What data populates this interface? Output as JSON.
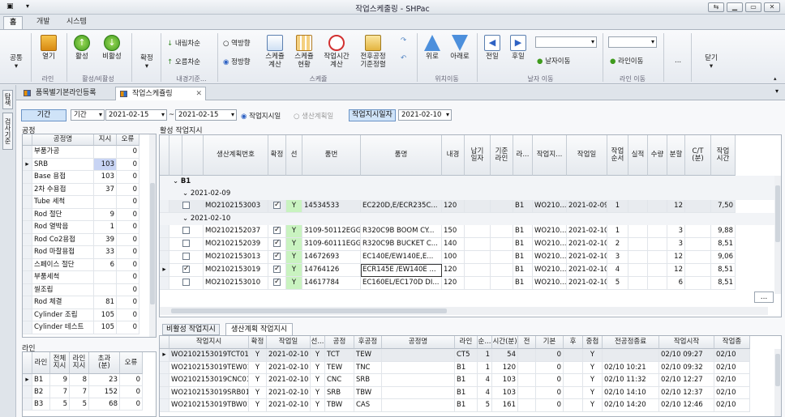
{
  "window": {
    "title": "작업스케줄링 - SHPac",
    "minimize": "▁",
    "restore": "▭",
    "close": "✕",
    "extra": "⇆",
    "menu": "▾"
  },
  "ribbon_tabs": [
    "홈",
    "개발",
    "시스템"
  ],
  "ribbon": {
    "buttons": [
      {
        "label": "공통",
        "icon": "common-icon"
      },
      {
        "label": "열기",
        "icon": "open-icon"
      },
      {
        "label": "활성",
        "icon": "activate-icon"
      },
      {
        "label": "비활성",
        "icon": "deactivate-icon"
      },
      {
        "label": "확정",
        "icon": "confirm-icon"
      },
      {
        "label": "스케쥴\n계산",
        "icon": "schedule-calc-icon"
      },
      {
        "label": "스케쥴\n현황",
        "icon": "schedule-status-icon"
      },
      {
        "label": "작업시간\n계산",
        "icon": "worktime-calc-icon"
      },
      {
        "label": "전후공정\n기준정렬",
        "icon": "process-sort-icon"
      },
      {
        "label": "위로",
        "icon": "up-icon"
      },
      {
        "label": "아래로",
        "icon": "down-icon"
      },
      {
        "label": "전일",
        "icon": "prev-day-icon"
      },
      {
        "label": "후일",
        "icon": "next-day-icon"
      },
      {
        "label": "닫기",
        "icon": "close-icon"
      }
    ],
    "sort_desc": "내림차순",
    "sort_asc": "오름차순",
    "reverse": "역방향",
    "forward": "정방향",
    "date_move": "날자이동",
    "line_move": "라인이동",
    "more": "...",
    "groups": [
      "라인",
      "활성/비활성",
      "내경기준...",
      "스케쥴",
      "위치이동",
      "날자 이동",
      "라인 이동"
    ]
  },
  "doc_tabs": [
    "품목별기본라인등록",
    "작업스케쥴링"
  ],
  "side_tabs": [
    "탐색",
    "검사기준"
  ],
  "filter": {
    "period_label": "기간",
    "period_type": "기간",
    "from": "2021-02-15",
    "to": "2021-02-15",
    "tilde": "~",
    "radio_work": "작업지시일",
    "radio_plan": "생산계획일",
    "work_date_label": "작업지시일자",
    "work_date": "2021-02-10"
  },
  "process": {
    "title": "공정",
    "headers": [
      "공정명",
      "지시",
      "오류"
    ],
    "rows": [
      [
        "부품가공",
        "",
        "0"
      ],
      [
        "SRB",
        "103",
        "0"
      ],
      [
        "Base 용접",
        "103",
        "0"
      ],
      [
        "2차 수용접",
        "37",
        "0"
      ],
      [
        "Tube 세척",
        "",
        "0"
      ],
      [
        "Rod 절단",
        "9",
        "0"
      ],
      [
        "Rod 열박음",
        "1",
        "0"
      ],
      [
        "Rod Co2용접",
        "39",
        "0"
      ],
      [
        "Rod 마찰용접",
        "33",
        "0"
      ],
      [
        "스페이스 절단",
        "6",
        "0"
      ],
      [
        "부품세척",
        "",
        "0"
      ],
      [
        "씰조립",
        "",
        "0"
      ],
      [
        "Rod 체결",
        "81",
        "0"
      ],
      [
        "Cylinder 조립",
        "105",
        "0"
      ],
      [
        "Cylinder 테스트",
        "105",
        "0"
      ]
    ]
  },
  "line": {
    "title": "라인",
    "headers": [
      "라인",
      "전체\n지시",
      "라인\n지시",
      "초과\n(분)",
      "오류"
    ],
    "rows": [
      [
        "B1",
        "9",
        "8",
        "23",
        "0"
      ],
      [
        "B2",
        "7",
        "7",
        "152",
        "0"
      ],
      [
        "B3",
        "5",
        "5",
        "68",
        "0"
      ]
    ]
  },
  "active": {
    "title": "활성 작업지시",
    "headers": [
      "생산계획번호",
      "확정",
      "선",
      "품번",
      "품명",
      "내경",
      "납기\n일자",
      "기준\n라인",
      "라...",
      "작업지...",
      "작업일",
      "작업\n순서",
      "실적",
      "수량",
      "분할",
      "C/T\n(분)",
      "작업\n시간"
    ],
    "group": "B1",
    "date1": "2021-02-09",
    "date2": "2021-02-10",
    "rows": [
      {
        "no": "MO2102153003",
        "conf": "✓",
        "sel": "Y",
        "part": "14534533",
        "name": "EC220D,E/ECR235C...",
        "bore": "120",
        "line": "B1",
        "wo": "WO210...",
        "date": "2021-02-09",
        "seq": "1",
        "qty": "12",
        "ct": "7,50"
      },
      {
        "no": "MO2102152037",
        "conf": "✓",
        "sel": "Y",
        "part": "3109-50112EGG",
        "name": "R320C9B BOOM CY...",
        "bore": "150",
        "line": "B1",
        "wo": "WO210...",
        "date": "2021-02-10",
        "seq": "1",
        "qty": "3",
        "ct": "9,88"
      },
      {
        "no": "MO2102152039",
        "conf": "✓",
        "sel": "Y",
        "part": "3109-60111EGG",
        "name": "R320C9B BUCKET C...",
        "bore": "140",
        "line": "B1",
        "wo": "WO210...",
        "date": "2021-02-10",
        "seq": "2",
        "qty": "3",
        "ct": "8,51"
      },
      {
        "no": "MO2102153013",
        "conf": "✓",
        "sel": "Y",
        "part": "14672693",
        "name": "EC140E/EW140E,E...",
        "bore": "100",
        "line": "B1",
        "wo": "WO210...",
        "date": "2021-02-10",
        "seq": "3",
        "qty": "12",
        "ct": "9,06"
      },
      {
        "no": "MO2102153019",
        "conf": "✓",
        "sel": "Y",
        "part": "14764126",
        "name": "ECR145E /EW140E ...",
        "bore": "120",
        "line": "B1",
        "wo": "WO210...",
        "date": "2021-02-10",
        "seq": "4",
        "qty": "12",
        "ct": "8,51"
      },
      {
        "no": "MO2102153010",
        "conf": "✓",
        "sel": "Y",
        "part": "14617784",
        "name": "EC160EL/EC170D DI...",
        "bore": "120",
        "line": "B1",
        "wo": "WO210...",
        "date": "2021-02-10",
        "seq": "5",
        "qty": "6",
        "ct": "8,51"
      }
    ]
  },
  "bottom_tabs": [
    "비활성 작업지시",
    "생산계획 작업지시"
  ],
  "bottom": {
    "headers": [
      "작업지시",
      "확정",
      "작업일",
      "선...",
      "공정",
      "후공정",
      "공정명",
      "라인",
      "순...",
      "시간(분)",
      "전",
      "기본",
      "후",
      "중첩",
      "전공정종료",
      "작업시작",
      "작업종"
    ],
    "rows": [
      [
        "WO2102153019TCT01",
        "Y",
        "2021-02-10",
        "Y",
        "TCT",
        "TEW",
        "",
        "CT5",
        "1",
        "54",
        "",
        "0",
        "",
        "Y",
        "",
        "02/10 09:27",
        "02/10"
      ],
      [
        "WO2102153019TEW01",
        "Y",
        "2021-02-10",
        "Y",
        "TEW",
        "TNC",
        "",
        "B1",
        "1",
        "120",
        "",
        "0",
        "",
        "Y",
        "02/10 10:21",
        "02/10 09:32",
        "02/10"
      ],
      [
        "WO2102153019CNC01",
        "Y",
        "2021-02-10",
        "Y",
        "CNC",
        "SRB",
        "",
        "B1",
        "4",
        "103",
        "",
        "0",
        "",
        "Y",
        "02/10 11:32",
        "02/10 12:27",
        "02/10"
      ],
      [
        "WO2102153019SRB01",
        "Y",
        "2021-02-10",
        "Y",
        "SRB",
        "TBW",
        "",
        "B1",
        "4",
        "103",
        "",
        "0",
        "",
        "Y",
        "02/10 14:10",
        "02/10 12:37",
        "02/10"
      ],
      [
        "WO2102153019TBW01",
        "Y",
        "2021-02-10",
        "Y",
        "TBW",
        "CAS",
        "",
        "B1",
        "5",
        "161",
        "",
        "0",
        "",
        "Y",
        "02/10 14:20",
        "02/10 12:46",
        "02/10"
      ]
    ]
  }
}
